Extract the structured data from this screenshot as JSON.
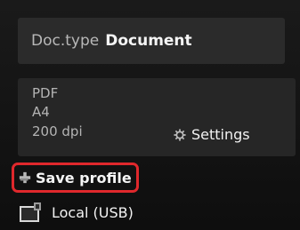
{
  "doc_type": {
    "key": "Doc.type",
    "value": "Document"
  },
  "summary": {
    "format": "PDF",
    "paper_size": "A4",
    "resolution": "200 dpi",
    "settings_label": "Settings"
  },
  "actions": {
    "save_profile_label": "Save profile",
    "destination_label": "Local (USB)"
  },
  "colors": {
    "highlight": "#e0282c",
    "background": "#111111"
  },
  "icons": {
    "settings": "gear-icon",
    "save": "plus-icon",
    "destination": "usb-device-icon"
  }
}
